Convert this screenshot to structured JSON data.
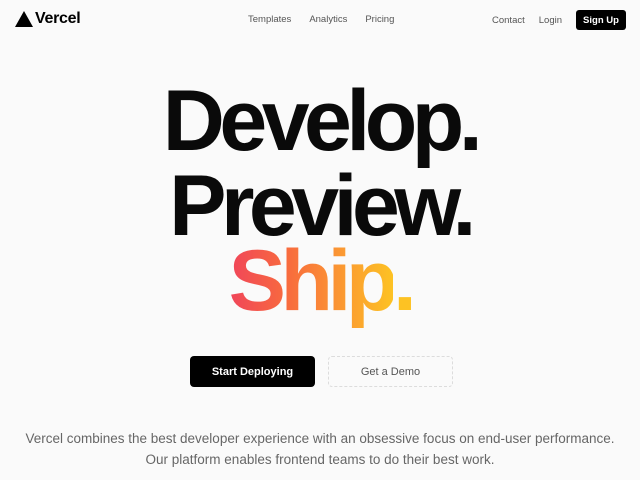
{
  "header": {
    "logo_text": "Vercel",
    "logo_icon": "triangle-icon",
    "nav": {
      "templates": "Templates",
      "analytics": "Analytics",
      "pricing": "Pricing"
    },
    "contact": "Contact",
    "login": "Login",
    "signup": "Sign Up"
  },
  "hero": {
    "line1": "Develop.",
    "line2": "Preview.",
    "line3_word": "Ship",
    "line3_dot": "."
  },
  "cta": {
    "primary": "Start Deploying",
    "secondary": "Get a Demo"
  },
  "tagline": {
    "line1": "Vercel combines the best developer experience with an obsessive focus on end-user performance.",
    "line2": "Our platform enables frontend teams to do their best work."
  },
  "colors": {
    "background": "#fafafa",
    "text": "#0a0a0a",
    "ship_gradient_start": "#f0455a",
    "ship_gradient_end": "#fdc223",
    "button_dark": "#000000"
  }
}
